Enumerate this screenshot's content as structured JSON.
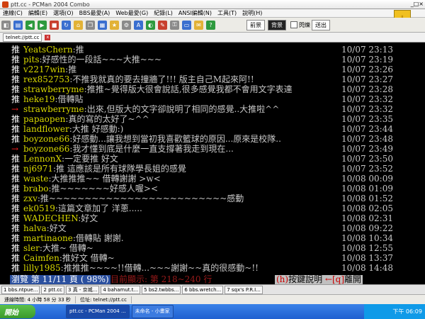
{
  "window": {
    "title": "ptt.cc - PCMan 2004 Combo",
    "min_label": "_",
    "max_label": "□",
    "close_label": "×"
  },
  "menu": [
    "連線(C)",
    "編輯(E)",
    "選項(O)",
    "BBS最愛(A)",
    "Web最愛(G)",
    "紀錄(L)",
    "ANSI編輯(N)",
    "工具(T)",
    "說明(H)"
  ],
  "toolbar": {
    "front_label": "前景",
    "back_label": "背景",
    "blink_label": "閃爍",
    "send_label": "送出"
  },
  "address": {
    "tab_label": "telnet://ptt.cc"
  },
  "terminal": {
    "rows": [
      {
        "tag": "推",
        "tag_color": "#ffffff",
        "user": "YeatsChern",
        "msg": ":推",
        "time": "10/07 23:13"
      },
      {
        "tag": "推",
        "tag_color": "#ffffff",
        "user": "pits",
        "msg": ":好感性的一段話~~~大推~~~",
        "time": "10/07 23:19"
      },
      {
        "tag": "推",
        "tag_color": "#ffffff",
        "user": "v2217win",
        "msg": ":推",
        "time": "10/07 23:26"
      },
      {
        "tag": "推",
        "tag_color": "#ffffff",
        "user": "rex852753",
        "msg": ":不推我就真的要去撞牆了!!!  版主自己M起來阿!!",
        "time": "10/07 23:27"
      },
      {
        "tag": "推",
        "tag_color": "#ffffff",
        "user": "strawberryme",
        "msg": ":推推~覺得版大很會說話,很多感覺我都不會用文字表達",
        "time": "10/07 23:28"
      },
      {
        "tag": "推",
        "tag_color": "#ffffff",
        "user": "heke19",
        "msg": ":借轉貼",
        "time": "10/07 23:32"
      },
      {
        "tag": "→",
        "tag_color": "#ff2020",
        "user": "strawberryme",
        "msg": ":出來,但版大的文字卻說明了相同的感覺..大推啦^^",
        "time": "10/07 23:32"
      },
      {
        "tag": "推",
        "tag_color": "#ffffff",
        "user": "papaopen",
        "msg": ":真的寫的太好了~^^",
        "time": "10/07 23:35"
      },
      {
        "tag": "推",
        "tag_color": "#ffffff",
        "user": "landflower",
        "msg": ":大推 好感動:)",
        "time": "10/07 23:44"
      },
      {
        "tag": "推",
        "tag_color": "#ffffff",
        "user": "boyzone66",
        "msg": ":好感動...讓我想到當初我喜歡籃球的原因...原來是校隊..",
        "time": "10/07 23:48"
      },
      {
        "tag": "→",
        "tag_color": "#ff2020",
        "user": "boyzone66",
        "msg": ":我才懂到底是什麼一直支撐著我走到現在...",
        "time": "10/07 23:49"
      },
      {
        "tag": "推",
        "tag_color": "#ffffff",
        "user": "LennonX",
        "msg": ":一定要推  好文",
        "time": "10/07 23:50"
      },
      {
        "tag": "推",
        "tag_color": "#ffffff",
        "user": "nj6971",
        "msg": ":推  這應該是所有球隊學長姐的感覺",
        "time": "10/07 23:52"
      },
      {
        "tag": "推",
        "tag_color": "#ffffff",
        "user": "waste",
        "msg": ":大推推推~~ 借轉謝謝 >w<",
        "time": "10/08 00:09"
      },
      {
        "tag": "推",
        "tag_color": "#ffffff",
        "user": "brabo",
        "msg": ":推~~~~~~~好感人喔><",
        "time": "10/08 01:09"
      },
      {
        "tag": "推",
        "tag_color": "#ffffff",
        "user": "zxv",
        "msg": ":推~~~~~~~~~~~~~~~~~~~~~~~~~感動",
        "time": "10/08 01:52"
      },
      {
        "tag": "推",
        "tag_color": "#ffffff",
        "user": "ek0519",
        "msg": ":這篇文章加了  洋蔥.....",
        "time": "10/08 02:05"
      },
      {
        "tag": "推",
        "tag_color": "#ffffff",
        "user": "WADECHEN",
        "msg": ":好文",
        "time": "10/08 02:31"
      },
      {
        "tag": "推",
        "tag_color": "#ffffff",
        "user": "halva",
        "msg": ":好文",
        "time": "10/08 09:22"
      },
      {
        "tag": "推",
        "tag_color": "#ffffff",
        "user": "martinaone",
        "msg": ":借轉貼 謝謝.",
        "time": "10/08 10:34"
      },
      {
        "tag": "推",
        "tag_color": "#ffffff",
        "user": "sler",
        "msg": ":大推~  借轉~",
        "time": "10/08 12:55"
      },
      {
        "tag": "推",
        "tag_color": "#ffffff",
        "user": "Caimfen",
        "msg": ":推好文 借轉~",
        "time": "10/08 13:37"
      },
      {
        "tag": "推",
        "tag_color": "#ffffff",
        "user": "lilly1985",
        "msg": ":推推推~~~~!!借轉...~~~謝謝~~真的很感動~!!",
        "time": "10/08 14:48"
      }
    ],
    "status": {
      "page": "瀏覽 第 11/11 頁 ( 98%)",
      "range": "目前顯示: 第 218~240 行",
      "help_key": "(h)",
      "help_label": "按鍵說明",
      "quit_key": "←[q]",
      "quit_label": "離開"
    }
  },
  "task_tabs": [
    "1 bbs.ntpue...",
    "2 ptt.cc",
    "3 真 - 京城...",
    "4 bahamut.t...",
    "5 bs2.twbbs...",
    "6 bbs.wretch...",
    "7 sqx's P.R.I..."
  ],
  "statusbar": {
    "conn_time": "連線時間: 4 小時 58 分 33 秒",
    "address": "位址: telnet://ptt.cc"
  },
  "taskbar": {
    "start_label": "開始",
    "buttons": [
      "ptt.cc - PCMan 2004 ...",
      "未命名 - 小畫家"
    ],
    "clock": "下午 06:09"
  }
}
